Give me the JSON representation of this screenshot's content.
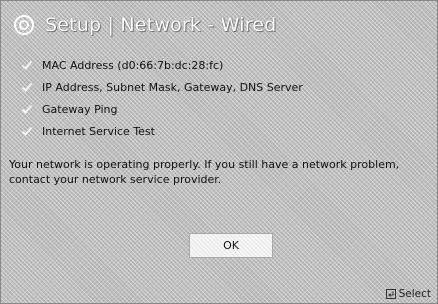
{
  "header": {
    "title": "Setup | Network - Wired",
    "icon": "setup-gear-icon"
  },
  "checks": [
    {
      "label": "MAC Address (d0:66:7b:dc:28:fc)",
      "icon": "check-icon"
    },
    {
      "label": "IP Address, Subnet Mask, Gateway, DNS Server",
      "icon": "check-icon"
    },
    {
      "label": "Gateway Ping",
      "icon": "check-icon"
    },
    {
      "label": "Internet Service Test",
      "icon": "check-icon"
    }
  ],
  "message": "Your network is operating properly. If you still have a network problem, contact your network service provider.",
  "buttons": {
    "ok_label": "OK"
  },
  "footer": {
    "select_label": "Select",
    "icon": "enter-key-icon"
  },
  "colors": {
    "background": "#bdbdbd",
    "title_text": "#ffffff",
    "body_text": "#111111",
    "button_background": "#ececec"
  }
}
